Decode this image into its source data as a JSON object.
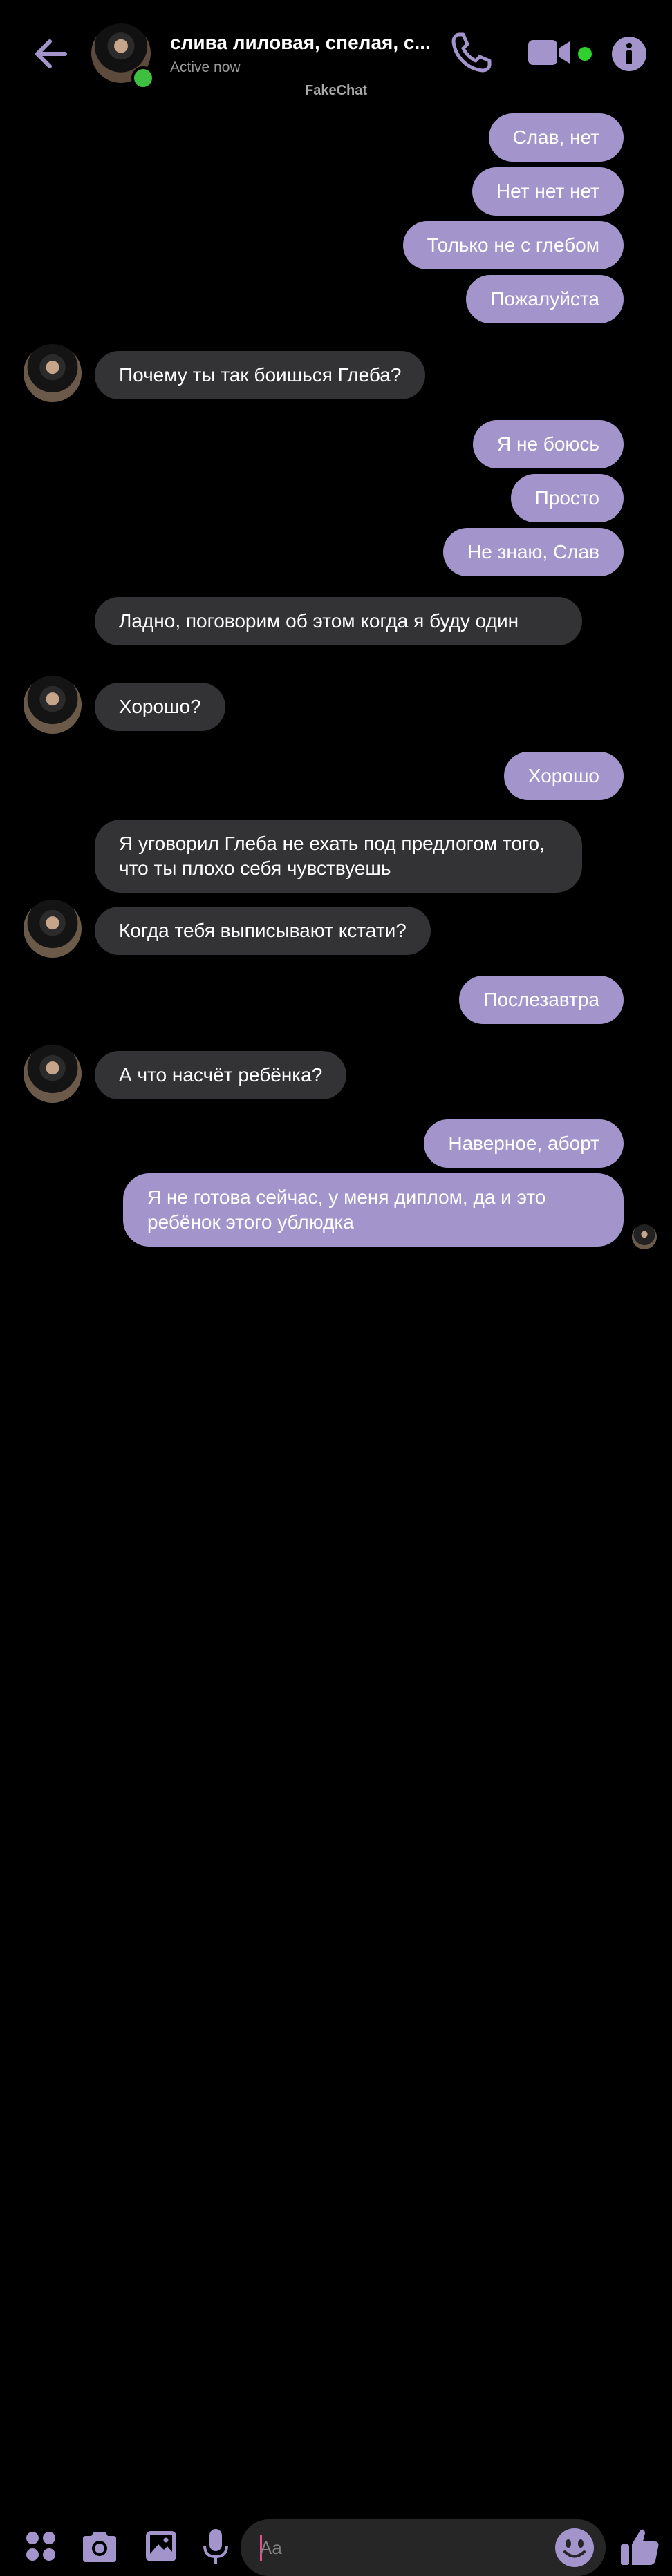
{
  "header": {
    "title": "слива лиловая, спелая, с...",
    "status": "Active now",
    "watermark": "FakeChat"
  },
  "messages": [
    {
      "side": "me",
      "text": "Слав, нет"
    },
    {
      "side": "me",
      "text": "Нет нет нет"
    },
    {
      "side": "me",
      "text": "Только не с глебом"
    },
    {
      "side": "me",
      "text": "Пожалуйста"
    },
    {
      "side": "them",
      "text": "Почему ты так боишься Глеба?"
    },
    {
      "side": "me",
      "text": "Я не боюсь"
    },
    {
      "side": "me",
      "text": "Просто"
    },
    {
      "side": "me",
      "text": "Не знаю,  Слав"
    },
    {
      "side": "them",
      "text": "Ладно, поговорим об этом когда я буду один"
    },
    {
      "side": "them",
      "text": "Хорошо?"
    },
    {
      "side": "me",
      "text": "Хорошо"
    },
    {
      "side": "them",
      "text": "Я уговорил Глеба не ехать под предлогом того, что ты плохо себя чувствуешь"
    },
    {
      "side": "them",
      "text": "Когда тебя выписывают кстати?"
    },
    {
      "side": "me",
      "text": "Послезавтра"
    },
    {
      "side": "them",
      "text": "А что насчёт ребёнка?"
    },
    {
      "side": "me",
      "text": "Наверное, аборт"
    },
    {
      "side": "me",
      "text": "Я не готова сейчас,  у меня диплом, да и это ребёнок этого ублюдка"
    }
  ],
  "composer": {
    "placeholder": "Aa"
  },
  "colors": {
    "accent": "#a395cc",
    "incoming": "#333235",
    "online": "#3fbf3f"
  },
  "icons": [
    "back-arrow-icon",
    "phone-icon",
    "video-camera-icon",
    "info-icon",
    "apps-grid-icon",
    "camera-icon",
    "image-icon",
    "microphone-icon",
    "emoji-icon",
    "thumbs-up-icon"
  ]
}
